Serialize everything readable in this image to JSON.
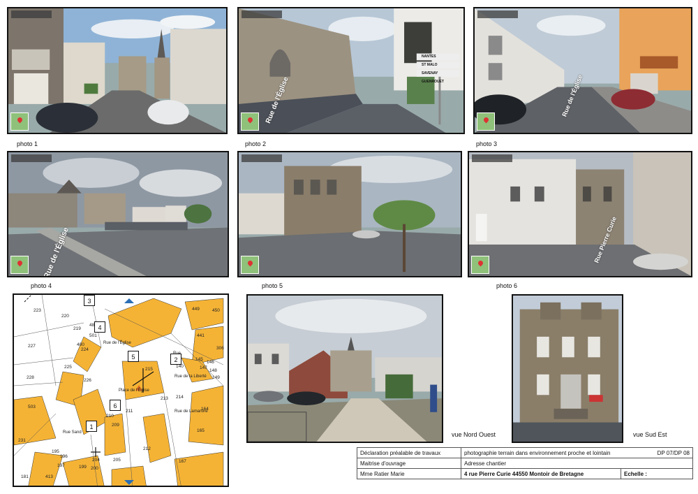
{
  "photos": [
    {
      "label": "photo 1",
      "street": ""
    },
    {
      "label": "photo 2",
      "street": "Rue de l'Église"
    },
    {
      "label": "photo 3",
      "street": "Rue de l'Église"
    },
    {
      "label": "photo 4",
      "street": "Rue de l'Église"
    },
    {
      "label": "photo 5",
      "street": ""
    },
    {
      "label": "photo 6",
      "street": "Rue Pierre Curie"
    }
  ],
  "sign": {
    "lines": [
      "NANTES",
      "ST MALO",
      "SAVENAY",
      "GUENROUET"
    ]
  },
  "map": {
    "parcels": [
      "223",
      "220",
      "219",
      "227",
      "228",
      "225",
      "224",
      "226",
      "400",
      "501",
      "483",
      "215",
      "213",
      "214",
      "209",
      "211",
      "210",
      "212",
      "204",
      "205",
      "195",
      "196",
      "197",
      "199",
      "200",
      "231",
      "413",
      "181",
      "449",
      "450",
      "441",
      "306",
      "145",
      "146",
      "147",
      "148",
      "149",
      "140",
      "164",
      "165",
      "167",
      "503"
    ],
    "streets": [
      "Rue de l'Église",
      "Rue",
      "Place de l'Église",
      "Rue Sand",
      "Rue de la Liberté",
      "Rue de Lamartine"
    ],
    "markers": [
      "3",
      "4",
      "5",
      "2",
      "6",
      "1"
    ]
  },
  "views": [
    {
      "label": "vue Nord Ouest"
    },
    {
      "label": "vue Sud Est"
    }
  ],
  "cartouche": {
    "title": "Déclaration préalable de travaux",
    "subtitle": "photographie terrain dans environnement proche et lointain",
    "ref": "DP 07/DP 08",
    "owner_label": "Maitrise d'ouvrage",
    "address_label": "Adresse chantier",
    "owner": "Mme Ratier Marie",
    "address": "4 rue Pierre Curie 44550 Montoir de Bretagne",
    "scale_label": "Echelle :"
  }
}
